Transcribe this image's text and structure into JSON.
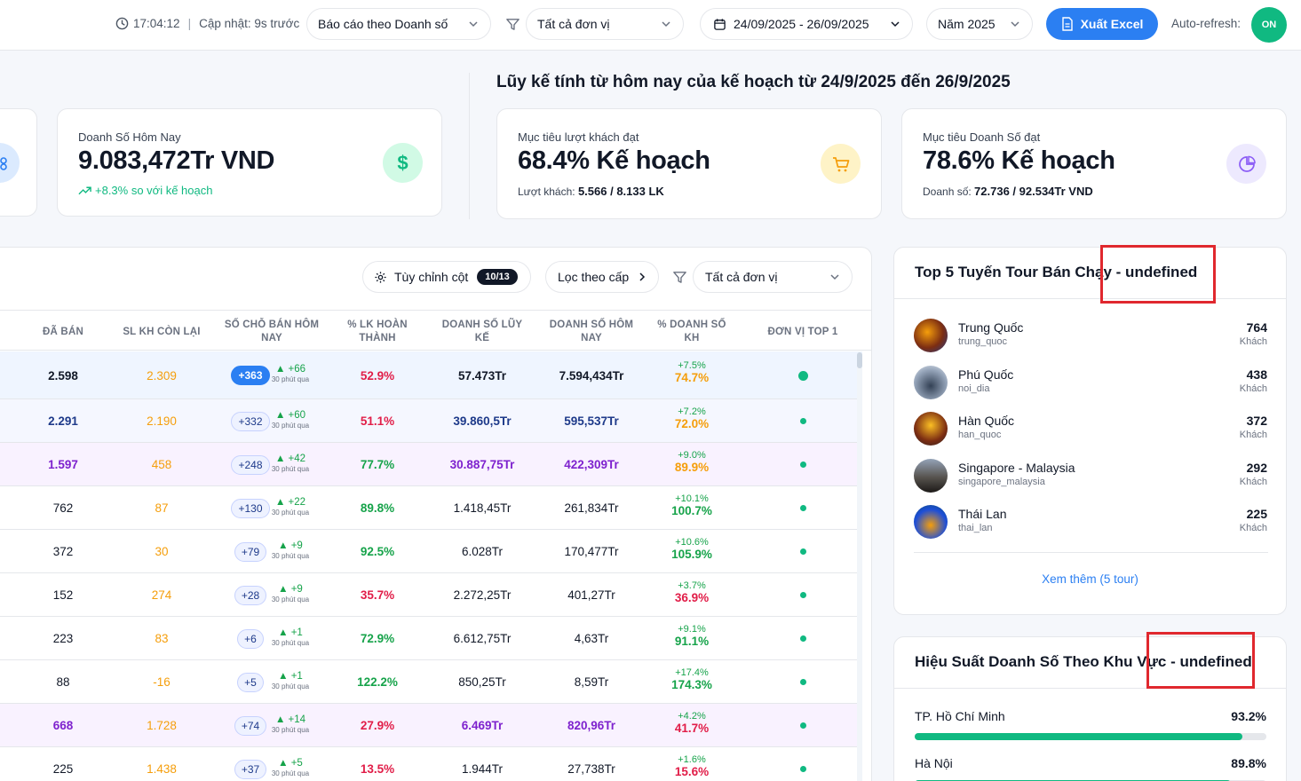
{
  "topbar": {
    "time": "17:04:12",
    "updated": "Cập nhật: 9s trước",
    "report_select": "Báo cáo theo Doanh số",
    "unit_select": "Tất cả đơn vị",
    "date_range": "24/09/2025 - 26/09/2025",
    "year_select": "Năm 2025",
    "export_label": "Xuất Excel",
    "auto_refresh_label": "Auto-refresh:",
    "auto_refresh_state": "ON"
  },
  "kpi": {
    "today_sales": {
      "label": "Doanh Số Hôm Nay",
      "value": "9.083,472Tr VND",
      "sub": "+8.3% so với kế hoạch"
    },
    "section_title": "Lũy kế tính từ hôm nay của kế hoạch từ 24/9/2025 đến 26/9/2025",
    "guest_target": {
      "label": "Mục tiêu lượt khách đạt",
      "value": "68.4% Kế hoạch",
      "sub_label": "Lượt khách:",
      "sub_value": "5.566 / 8.133 LK"
    },
    "sales_target": {
      "label": "Mục tiêu Doanh Số đạt",
      "value": "78.6% Kế hoạch",
      "sub_label": "Doanh số:",
      "sub_value": "72.736 / 92.534Tr VND"
    }
  },
  "table": {
    "customize_label": "Tùy chỉnh cột",
    "customize_count": "10/13",
    "level_filter": "Lọc theo cấp",
    "unit_filter": "Tất cả đơn vị",
    "headers": [
      "ĐÃ BÁN",
      "SL KH CÒN LẠI",
      "SỐ CHỖ BÁN HÔM NAY",
      "% LK HOÀN THÀNH",
      "DOANH SỐ LŨY KẾ",
      "DOANH SỐ HÔM NAY",
      "% DOANH SỐ KH",
      "ĐƠN VỊ TOP 1"
    ],
    "delta_note": "30 phút qua",
    "rows": [
      {
        "sold": "2.598",
        "remaining": "2.309",
        "seats_today": "+363",
        "delta": "▲ +66",
        "lk_pct": "52.9%",
        "cum_sales": "57.473Tr",
        "today_sales": "7.594,434Tr",
        "kh_up": "+7.5%",
        "kh_pct": "74.7%"
      },
      {
        "sold": "2.291",
        "remaining": "2.190",
        "seats_today": "+332",
        "delta": "▲ +60",
        "lk_pct": "51.1%",
        "cum_sales": "39.860,5Tr",
        "today_sales": "595,537Tr",
        "kh_up": "+7.2%",
        "kh_pct": "72.0%"
      },
      {
        "sold": "1.597",
        "remaining": "458",
        "seats_today": "+248",
        "delta": "▲ +42",
        "lk_pct": "77.7%",
        "cum_sales": "30.887,75Tr",
        "today_sales": "422,309Tr",
        "kh_up": "+9.0%",
        "kh_pct": "89.9%"
      },
      {
        "sold": "762",
        "remaining": "87",
        "seats_today": "+130",
        "delta": "▲ +22",
        "lk_pct": "89.8%",
        "cum_sales": "1.418,45Tr",
        "today_sales": "261,834Tr",
        "kh_up": "+10.1%",
        "kh_pct": "100.7%"
      },
      {
        "sold": "372",
        "remaining": "30",
        "seats_today": "+79",
        "delta": "▲ +9",
        "lk_pct": "92.5%",
        "cum_sales": "6.028Tr",
        "today_sales": "170,477Tr",
        "kh_up": "+10.6%",
        "kh_pct": "105.9%"
      },
      {
        "sold": "152",
        "remaining": "274",
        "seats_today": "+28",
        "delta": "▲ +9",
        "lk_pct": "35.7%",
        "cum_sales": "2.272,25Tr",
        "today_sales": "401,27Tr",
        "kh_up": "+3.7%",
        "kh_pct": "36.9%"
      },
      {
        "sold": "223",
        "remaining": "83",
        "seats_today": "+6",
        "delta": "▲ +1",
        "lk_pct": "72.9%",
        "cum_sales": "6.612,75Tr",
        "today_sales": "4,63Tr",
        "kh_up": "+9.1%",
        "kh_pct": "91.1%"
      },
      {
        "sold": "88",
        "remaining": "-16",
        "seats_today": "+5",
        "delta": "▲ +1",
        "lk_pct": "122.2%",
        "cum_sales": "850,25Tr",
        "today_sales": "8,59Tr",
        "kh_up": "+17.4%",
        "kh_pct": "174.3%"
      },
      {
        "sold": "668",
        "remaining": "1.728",
        "seats_today": "+74",
        "delta": "▲ +14",
        "lk_pct": "27.9%",
        "cum_sales": "6.469Tr",
        "today_sales": "820,96Tr",
        "kh_up": "+4.2%",
        "kh_pct": "41.7%"
      },
      {
        "sold": "225",
        "remaining": "1.438",
        "seats_today": "+37",
        "delta": "▲ +5",
        "lk_pct": "13.5%",
        "cum_sales": "1.944Tr",
        "today_sales": "27,738Tr",
        "kh_up": "+1.6%",
        "kh_pct": "15.6%"
      }
    ]
  },
  "top_tours": {
    "title": "Top 5 Tuyến Tour Bán Chạy - undefined",
    "items": [
      {
        "name": "Trung Quốc",
        "code": "trung_quoc",
        "count": "764",
        "unit": "Khách"
      },
      {
        "name": "Phú Quốc",
        "code": "noi_dia",
        "count": "438",
        "unit": "Khách"
      },
      {
        "name": "Hàn Quốc",
        "code": "han_quoc",
        "count": "372",
        "unit": "Khách"
      },
      {
        "name": "Singapore - Malaysia",
        "code": "singapore_malaysia",
        "count": "292",
        "unit": "Khách"
      },
      {
        "name": "Thái Lan",
        "code": "thai_lan",
        "count": "225",
        "unit": "Khách"
      }
    ],
    "more_link": "Xem thêm (5 tour)"
  },
  "region_perf": {
    "title": "Hiệu Suất Doanh Số Theo Khu Vực - undefined",
    "items": [
      {
        "name": "TP. Hồ Chí Minh",
        "pct": "93.2%",
        "fill": 0.932
      },
      {
        "name": "Hà Nội",
        "pct": "89.8%",
        "fill": 0.898
      }
    ]
  },
  "colors": {
    "accent": "#2b7ff2",
    "success": "#10b981",
    "warning": "#f59e0b",
    "danger": "#e11d48",
    "highlight_box": "#e0282e"
  }
}
